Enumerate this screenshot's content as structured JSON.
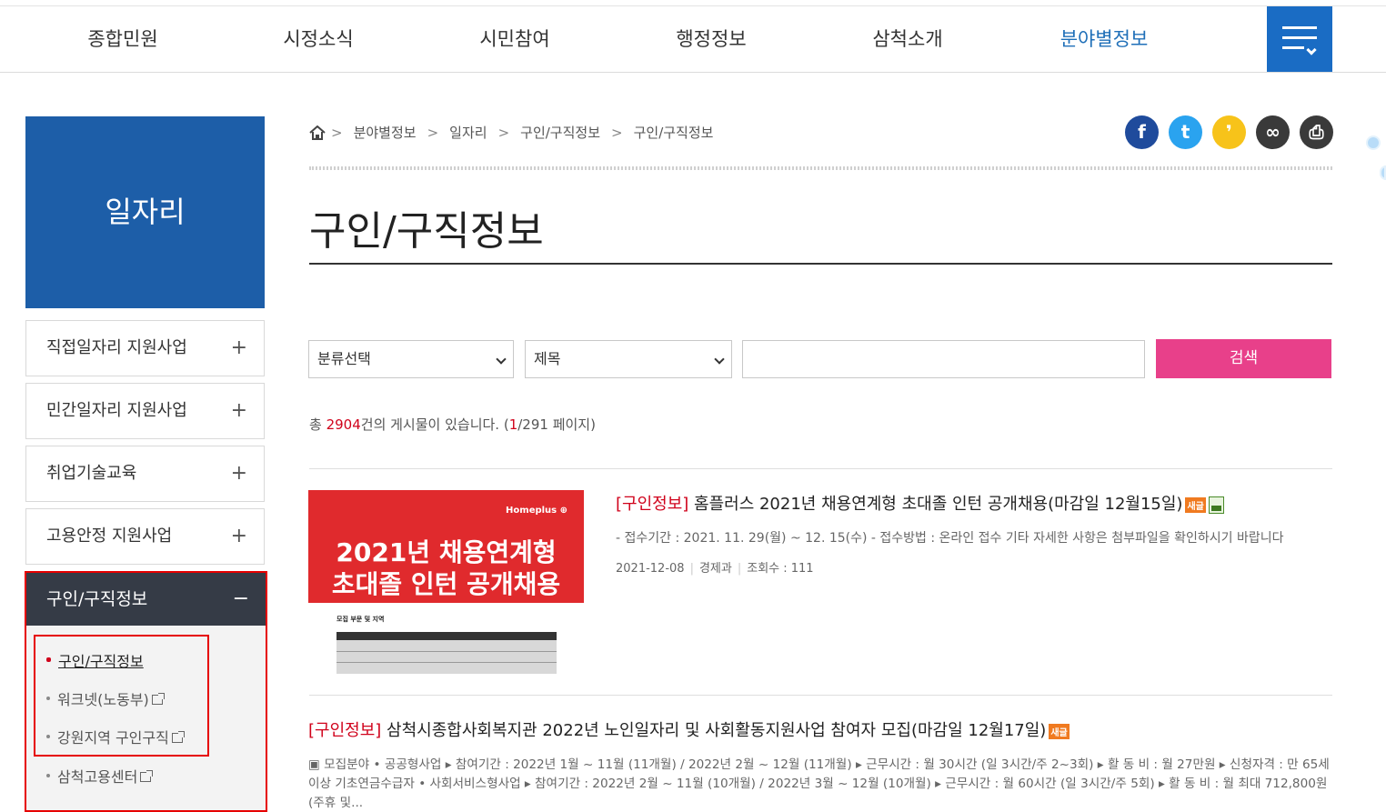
{
  "topnav": {
    "items": [
      "종합민원",
      "시정소식",
      "시민참여",
      "행정정보",
      "삼척소개",
      "분야별정보"
    ],
    "active_index": 5
  },
  "sidebar": {
    "banner": "일자리",
    "items": [
      {
        "label": "직접일자리 지원사업",
        "symbol": "+"
      },
      {
        "label": "민간일자리 지원사업",
        "symbol": "+"
      },
      {
        "label": "취업기술교육",
        "symbol": "+"
      },
      {
        "label": "고용안정 지원사업",
        "symbol": "+"
      }
    ],
    "active": {
      "label": "구인/구직정보",
      "symbol": "−",
      "sub_items": [
        {
          "label": "구인/구직정보",
          "current": true,
          "external": false
        },
        {
          "label": "워크넷(노동부)",
          "current": false,
          "external": true
        },
        {
          "label": "강원지역 구인구직",
          "current": false,
          "external": true
        },
        {
          "label": "삼척고용센터",
          "current": false,
          "external": true
        }
      ]
    }
  },
  "breadcrumb": [
    "분야별정보",
    "일자리",
    "구인/구직정보",
    "구인/구직정보"
  ],
  "share": [
    {
      "name": "facebook",
      "glyph": "f",
      "color": "#1f4b9c"
    },
    {
      "name": "twitter",
      "glyph": "t",
      "color": "#2aa3ef"
    },
    {
      "name": "kakao",
      "glyph": "❜",
      "color": "#f7c31a"
    },
    {
      "name": "link",
      "glyph": "∞",
      "color": "#3a3a3a"
    },
    {
      "name": "print",
      "glyph": "⎙",
      "color": "#3a3a3a"
    }
  ],
  "page_title": "구인/구직정보",
  "search": {
    "category": "분류선택",
    "field": "제목",
    "keyword": "",
    "button": "검색"
  },
  "count": {
    "prefix": "총 ",
    "total": "2904",
    "mid": "건의 게시물이 있습니다. (",
    "page": "1",
    "suffix": "/291 페이지)"
  },
  "posts": [
    {
      "tag": "[구인정보]",
      "title": " 홈플러스 2021년 채용연계형 초대졸 인턴 공개채용(마감일 12월15일)",
      "new_badge": "새글",
      "desc": "- 접수기간 : 2021. 11. 29(월) ~ 12. 15(수) - 접수방법 : 온라인 접수 기타 자세한 사항은 첨부파일을 확인하시기 바랍니다",
      "date": "2021-12-08",
      "dept": "경제과",
      "views": "조회수 : 111",
      "thumb": {
        "brand": "Homeplus ⊕",
        "line1": "2021년 채용연계형",
        "line2": "초대졸 인턴 공개채용",
        "small": "모집 부문 및 지역"
      }
    },
    {
      "tag": "[구인정보]",
      "title": " 삼척시종합사회복지관 2022년 노인일자리 및 사회활동지원사업 참여자 모집(마감일 12월17일)",
      "new_badge": "새글",
      "desc1": "▣ 모집분야 • 공공형사업 ▸ 참여기간 : 2022년 1월 ~ 11월 (11개월) / 2022년 2월 ~ 12월 (11개월) ▸ 근무시간 : 월 30시간 (일 3시간/주 2~3회) ▸ 활 동 비 : 월 27만원 ▸ 신청자격 : 만 65세",
      "desc2": "이상 기초연금수급자 • 사회서비스형사업 ▸ 참여기간 : 2022년 2월 ~ 11월 (10개월) / 2022년 3월 ~ 12월 (10개월) ▸ 근무시간 : 월 60시간 (일 3시간/주 5회) ▸ 활 동 비 : 월 최대 712,800원",
      "desc3": "(주휴 및..."
    }
  ]
}
